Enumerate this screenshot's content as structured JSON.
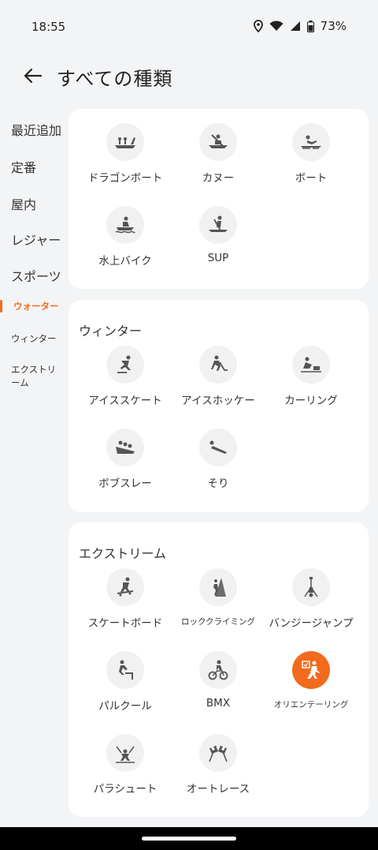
{
  "status": {
    "time": "18:55",
    "battery": "73%"
  },
  "header": {
    "title": "すべての種類"
  },
  "sidebar": {
    "items": [
      {
        "label": "最近追加"
      },
      {
        "label": "定番"
      },
      {
        "label": "屋内"
      },
      {
        "label": "レジャー"
      },
      {
        "label": "スポーツ"
      },
      {
        "label": "ウォーター"
      },
      {
        "label": "ウィンター"
      },
      {
        "label": "エクストリーム"
      }
    ],
    "active_index": 5
  },
  "water": {
    "items": [
      {
        "label": "ドラゴンボート",
        "icon": "dragon-boat-icon"
      },
      {
        "label": "カヌー",
        "icon": "canoe-icon"
      },
      {
        "label": "ボート",
        "icon": "rowing-icon"
      },
      {
        "label": "水上バイク",
        "icon": "jet-ski-icon"
      },
      {
        "label": "SUP",
        "icon": "sup-icon"
      }
    ]
  },
  "winter": {
    "title": "ウィンター",
    "items": [
      {
        "label": "アイススケート",
        "icon": "ice-skate-icon"
      },
      {
        "label": "アイスホッケー",
        "icon": "ice-hockey-icon"
      },
      {
        "label": "カーリング",
        "icon": "curling-icon"
      },
      {
        "label": "ボブスレー",
        "icon": "bobsled-icon"
      },
      {
        "label": "そり",
        "icon": "sled-icon"
      }
    ]
  },
  "extreme": {
    "title": "エクストリーム",
    "items": [
      {
        "label": "スケートボード",
        "icon": "skateboard-icon"
      },
      {
        "label": "ロッククライミング",
        "icon": "rock-climbing-icon"
      },
      {
        "label": "バンジージャンプ",
        "icon": "bungee-jump-icon"
      },
      {
        "label": "パルクール",
        "icon": "parkour-icon"
      },
      {
        "label": "BMX",
        "icon": "bmx-icon"
      },
      {
        "label": "オリエンテーリング",
        "icon": "orienteering-icon",
        "selected": true
      },
      {
        "label": "パラシュート",
        "icon": "parachute-icon"
      },
      {
        "label": "オートレース",
        "icon": "auto-race-icon"
      }
    ]
  },
  "colors": {
    "accent": "#f26b1d",
    "icon": "#555555",
    "background": "#f3f4f6"
  }
}
